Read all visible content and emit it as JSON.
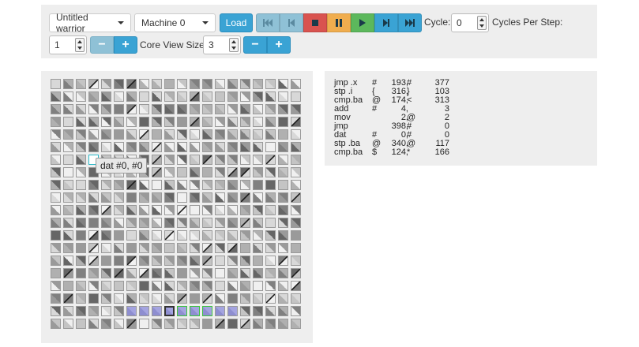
{
  "toolbar": {
    "warrior_select": "Untitled warrior",
    "machine_select": "Machine 0",
    "load_label": "Load",
    "cycle_label": "Cycle:",
    "cycle_value": "0",
    "cycles_per_step_label": "Cycles Per Step:",
    "cycles_per_step_value": "1",
    "core_view_size_label": "Core View Size:",
    "core_view_size_value": "3",
    "minus_label": "−",
    "plus_label": "+",
    "controls": [
      {
        "name": "rewind-to-start",
        "icon": "skip-back-icon",
        "color": "#8fc1d6"
      },
      {
        "name": "step-back",
        "icon": "step-back-icon",
        "color": "#8fc1d6"
      },
      {
        "name": "stop",
        "icon": "stop-icon",
        "color": "#d9534f"
      },
      {
        "name": "pause",
        "icon": "pause-icon",
        "color": "#f0ad4e"
      },
      {
        "name": "play",
        "icon": "play-icon",
        "color": "#5cb85c"
      },
      {
        "name": "step-forward",
        "icon": "step-forward-icon",
        "color": "#3aa3d4"
      },
      {
        "name": "fast-forward",
        "icon": "fast-forward-icon",
        "color": "#3aa3d4"
      }
    ]
  },
  "core_view": {
    "rows": 20,
    "cols": 20,
    "tooltip": "dat #0, #0"
  },
  "code": [
    [
      "jmp .x",
      "#",
      "193,",
      "#",
      "377"
    ],
    [
      "stp .i",
      "{",
      "316,",
      "}",
      "103"
    ],
    [
      "cmp.ba",
      "@",
      "174,",
      "<",
      "313"
    ],
    [
      "add",
      "#",
      "4,",
      "",
      "3"
    ],
    [
      "mov",
      "",
      "2,",
      "@",
      "2"
    ],
    [
      "jmp",
      "",
      "398,",
      "#",
      "0"
    ],
    [
      "dat",
      "#",
      "0,",
      "#",
      "0"
    ],
    [
      "stp .ba",
      "@",
      "340,",
      "@",
      "117"
    ],
    [
      "cmp.ba",
      "$",
      "124,",
      "*",
      "166"
    ]
  ]
}
